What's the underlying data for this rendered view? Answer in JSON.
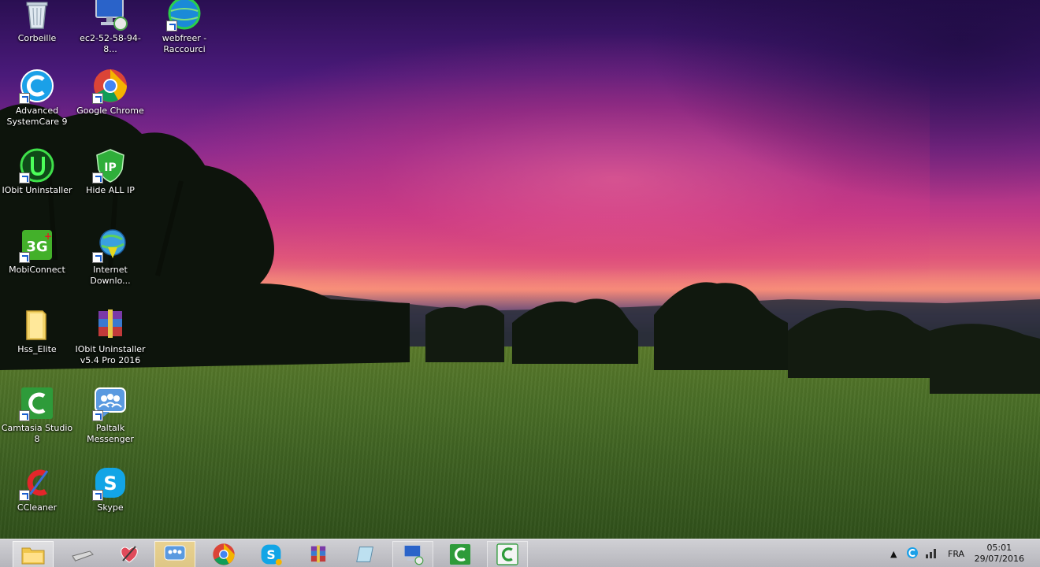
{
  "desktop": {
    "icons": [
      {
        "label": "Corbeille",
        "icon": "recycle-bin-icon"
      },
      {
        "label": "ec2-52-58-94-8...",
        "icon": "remote-desktop-icon"
      },
      {
        "label": "webfreer - Raccourci",
        "icon": "webfreer-icon"
      },
      {
        "label": "Advanced SystemCare 9",
        "icon": "advanced-systemcare-icon"
      },
      {
        "label": "Google Chrome",
        "icon": "chrome-icon"
      },
      {
        "label": "IObit Uninstaller",
        "icon": "iobit-uninstaller-icon"
      },
      {
        "label": "Hide ALL IP",
        "icon": "hide-all-ip-icon"
      },
      {
        "label": "MobiConnect",
        "icon": "mobiconnect-icon"
      },
      {
        "label": "Internet Downlo...",
        "icon": "internet-download-manager-icon"
      },
      {
        "label": "Hss_Elite",
        "icon": "folder-icon"
      },
      {
        "label": "IObit Uninstaller v5.4 Pro 2016",
        "icon": "winrar-archive-icon"
      },
      {
        "label": "Camtasia Studio 8",
        "icon": "camtasia-icon"
      },
      {
        "label": "Paltalk Messenger",
        "icon": "paltalk-icon"
      },
      {
        "label": "CCleaner",
        "icon": "ccleaner-icon"
      },
      {
        "label": "Skype",
        "icon": "skype-icon"
      }
    ]
  },
  "taskbar": {
    "buttons": [
      {
        "icon": "file-explorer-icon",
        "state": "active"
      },
      {
        "icon": "scanner-icon",
        "state": "normal"
      },
      {
        "icon": "heart-pen-icon",
        "state": "normal"
      },
      {
        "icon": "paltalk-icon",
        "state": "active"
      },
      {
        "icon": "chrome-icon",
        "state": "normal"
      },
      {
        "icon": "skype-icon",
        "state": "normal"
      },
      {
        "icon": "winrar-icon",
        "state": "normal"
      },
      {
        "icon": "notepad-icon",
        "state": "normal"
      },
      {
        "icon": "remote-desktop-icon",
        "state": "running"
      },
      {
        "icon": "camtasia-icon",
        "state": "normal"
      },
      {
        "icon": "camtasia-recorder-icon",
        "state": "running"
      }
    ],
    "tray": {
      "language": "FRA",
      "time": "05:01",
      "date": "29/07/2016"
    }
  },
  "colors": {
    "sky_top": "#2a0f52",
    "sky_pink": "#e0587a",
    "grass": "#4c7028",
    "taskbar": "#b4b4ba"
  }
}
